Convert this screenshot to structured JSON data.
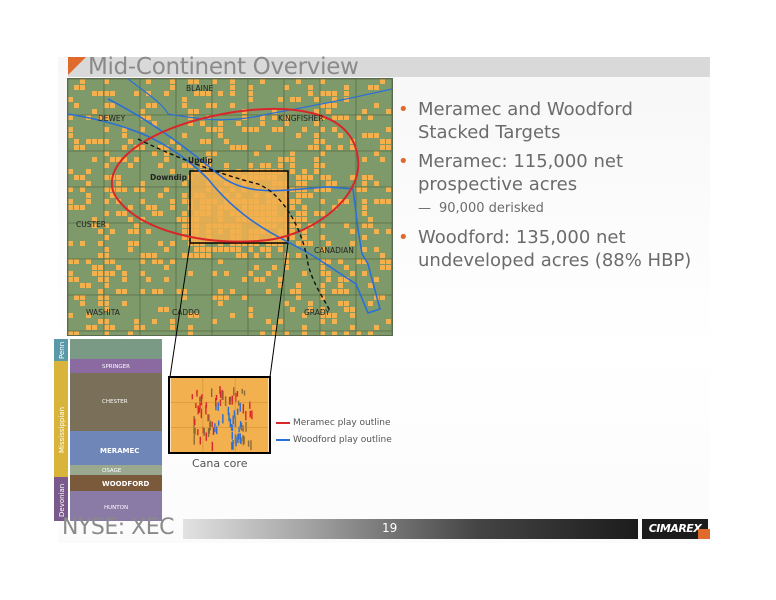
{
  "slide": {
    "title": "Mid-Continent Overview",
    "page_number": "19",
    "ticker": "NYSE: XEC",
    "logo_text": "CIMAREX"
  },
  "map": {
    "county_labels": [
      "BLAINE",
      "DEWEY",
      "KINGFISHER",
      "CUSTER",
      "CANADIAN",
      "WASHITA",
      "CADDO",
      "GRADY"
    ],
    "updip_label": "Updip",
    "downdip_label": "Downdip"
  },
  "bullets": [
    {
      "text_line1": "Meramec and Woodford",
      "text_line2": "Stacked Targets"
    },
    {
      "text_line1": "Meramec: 115,000 net",
      "text_line2": "prospective acres",
      "sub": "90,000 derisked"
    },
    {
      "text_line1": "Woodford: 135,000 net",
      "text_line2": "undeveloped acres (88% HBP)"
    }
  ],
  "stratigraphy": {
    "periods": [
      "Penn",
      "Mississippian",
      "Devonian"
    ],
    "units": [
      "SPRINGER",
      "CHESTER",
      "MERAMEC",
      "OSAGE",
      "WOODFORD",
      "HUNTON"
    ]
  },
  "inset": {
    "caption": "Cana core"
  },
  "legend": [
    {
      "label": "Meramec play outline",
      "color": "#d9262b"
    },
    {
      "label": "Woodford play outline",
      "color": "#2b6fd6"
    }
  ],
  "colors": {
    "accent": "#e06a2c",
    "map_green": "#7f9a6a",
    "acreage_orange": "#f2b04f"
  }
}
